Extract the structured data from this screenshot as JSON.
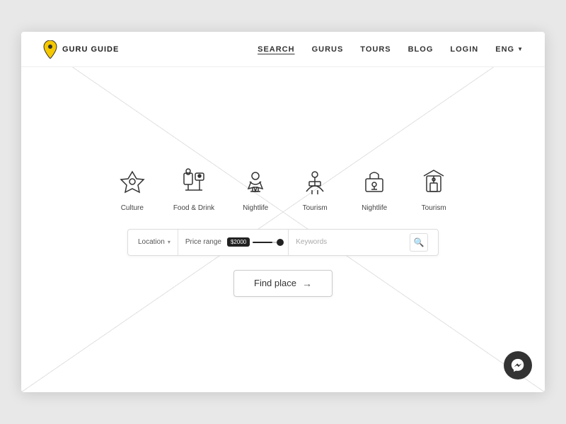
{
  "nav": {
    "logo_text": "GURU GUIDE",
    "links": [
      {
        "id": "search",
        "label": "SEARCH",
        "active": true
      },
      {
        "id": "gurus",
        "label": "GURUS",
        "active": false
      },
      {
        "id": "tours",
        "label": "TOURS",
        "active": false
      },
      {
        "id": "blog",
        "label": "BLOG",
        "active": false
      },
      {
        "id": "login",
        "label": "LOGIN",
        "active": false
      },
      {
        "id": "lang",
        "label": "ENG",
        "active": false
      }
    ]
  },
  "categories": [
    {
      "id": "culture",
      "label": "Culture"
    },
    {
      "id": "food-drink",
      "label": "Food & Drink"
    },
    {
      "id": "nightlife",
      "label": "Nightlife"
    },
    {
      "id": "tourism",
      "label": "Tourism"
    },
    {
      "id": "nightlife2",
      "label": "Nightlife"
    },
    {
      "id": "tourism2",
      "label": "Tourism"
    }
  ],
  "search_bar": {
    "location_label": "Location",
    "price_label": "Price range",
    "price_value": "$2000",
    "keywords_placeholder": "Keywords"
  },
  "find_place_btn": "Find place",
  "messenger_icon": "💬"
}
